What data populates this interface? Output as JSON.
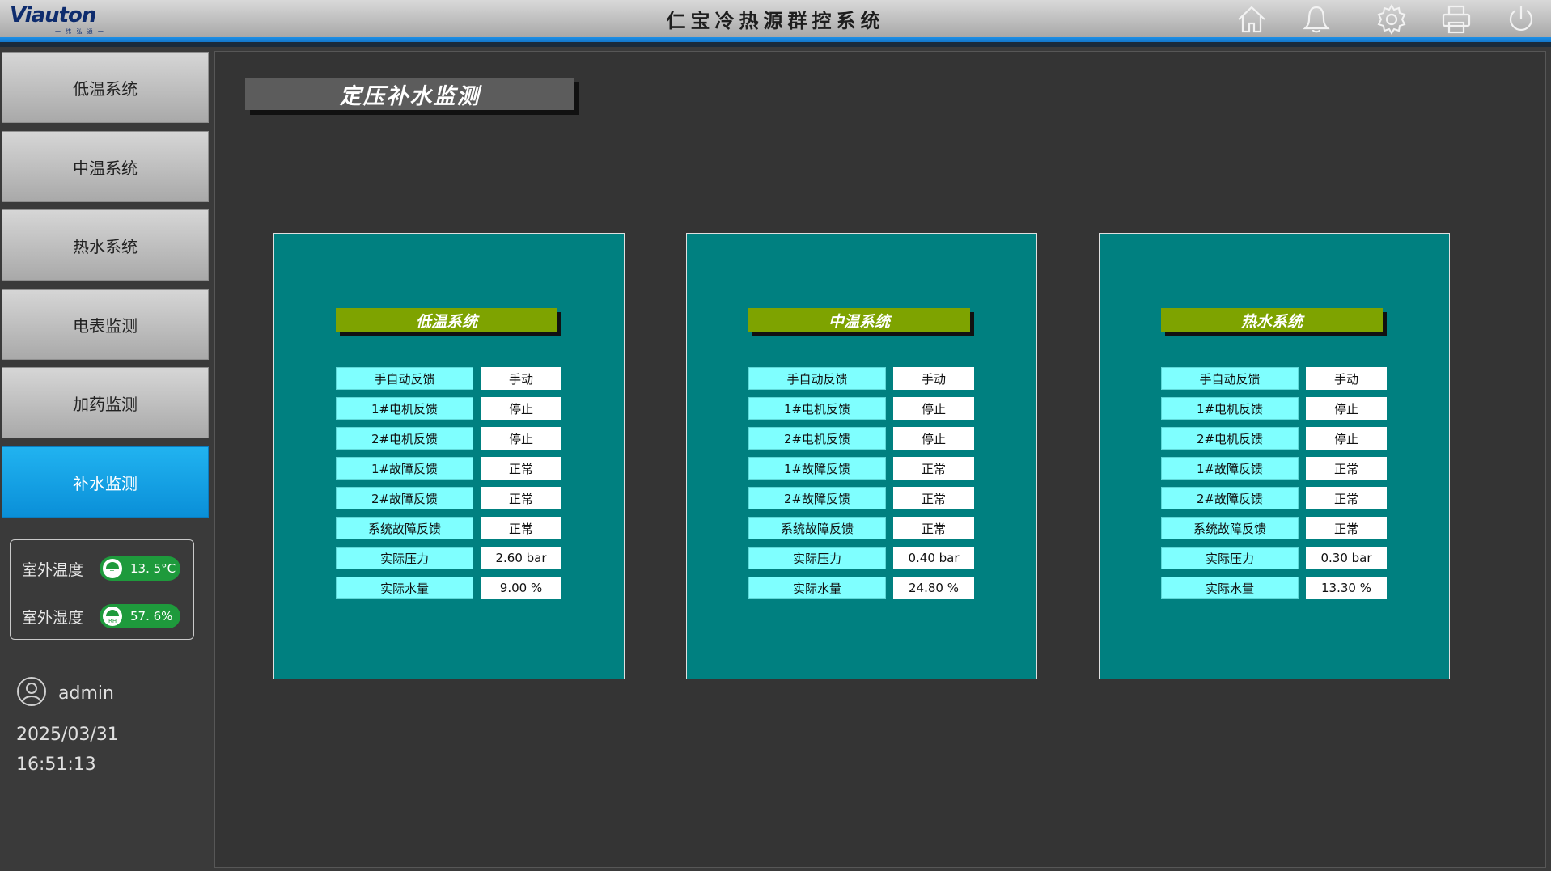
{
  "header": {
    "logo_text": "Viauton",
    "logo_sub": "一 纬 弘 通 一",
    "title": "仁宝冷热源群控系统",
    "icons": [
      "home-icon",
      "bell-icon",
      "gear-icon",
      "printer-icon",
      "power-icon"
    ]
  },
  "sidebar": {
    "items": [
      {
        "label": "低温系统",
        "active": false
      },
      {
        "label": "中温系统",
        "active": false
      },
      {
        "label": "热水系统",
        "active": false
      },
      {
        "label": "电表监测",
        "active": false
      },
      {
        "label": "加药监测",
        "active": false
      },
      {
        "label": "补水监测",
        "active": true
      }
    ],
    "weather": {
      "temp_label": "室外温度",
      "temp_value": "13. 5°C",
      "temp_unit_letter": "T",
      "hum_label": "室外湿度",
      "hum_value": "57. 6%",
      "hum_unit_letter": "RH"
    },
    "user": "admin",
    "date": "2025/03/31",
    "time": "16:51:13"
  },
  "main": {
    "title": "定压补水监测",
    "panels": [
      {
        "title": "低温系统",
        "rows": [
          {
            "label": "手自动反馈",
            "value": "手动"
          },
          {
            "label": "1#电机反馈",
            "value": "停止"
          },
          {
            "label": "2#电机反馈",
            "value": "停止"
          },
          {
            "label": "1#故障反馈",
            "value": "正常"
          },
          {
            "label": "2#故障反馈",
            "value": "正常"
          },
          {
            "label": "系统故障反馈",
            "value": "正常"
          },
          {
            "label": "实际压力",
            "value": "2.60 bar"
          },
          {
            "label": "实际水量",
            "value": "9.00 %"
          }
        ]
      },
      {
        "title": "中温系统",
        "rows": [
          {
            "label": "手自动反馈",
            "value": "手动"
          },
          {
            "label": "1#电机反馈",
            "value": "停止"
          },
          {
            "label": "2#电机反馈",
            "value": "停止"
          },
          {
            "label": "1#故障反馈",
            "value": "正常"
          },
          {
            "label": "2#故障反馈",
            "value": "正常"
          },
          {
            "label": "系统故障反馈",
            "value": "正常"
          },
          {
            "label": "实际压力",
            "value": "0.40 bar"
          },
          {
            "label": "实际水量",
            "value": "24.80 %"
          }
        ]
      },
      {
        "title": "热水系统",
        "rows": [
          {
            "label": "手自动反馈",
            "value": "手动"
          },
          {
            "label": "1#电机反馈",
            "value": "停止"
          },
          {
            "label": "2#电机反馈",
            "value": "停止"
          },
          {
            "label": "1#故障反馈",
            "value": "正常"
          },
          {
            "label": "2#故障反馈",
            "value": "正常"
          },
          {
            "label": "系统故障反馈",
            "value": "正常"
          },
          {
            "label": "实际压力",
            "value": "0.30 bar"
          },
          {
            "label": "实际水量",
            "value": "13.30 %"
          }
        ]
      }
    ]
  },
  "colors": {
    "accent": "#0a8fd8",
    "panel_bg": "#008080",
    "panel_title_bg": "#7ea300",
    "label_bg": "#7fffff",
    "weather_pill": "#1e9a3c"
  }
}
